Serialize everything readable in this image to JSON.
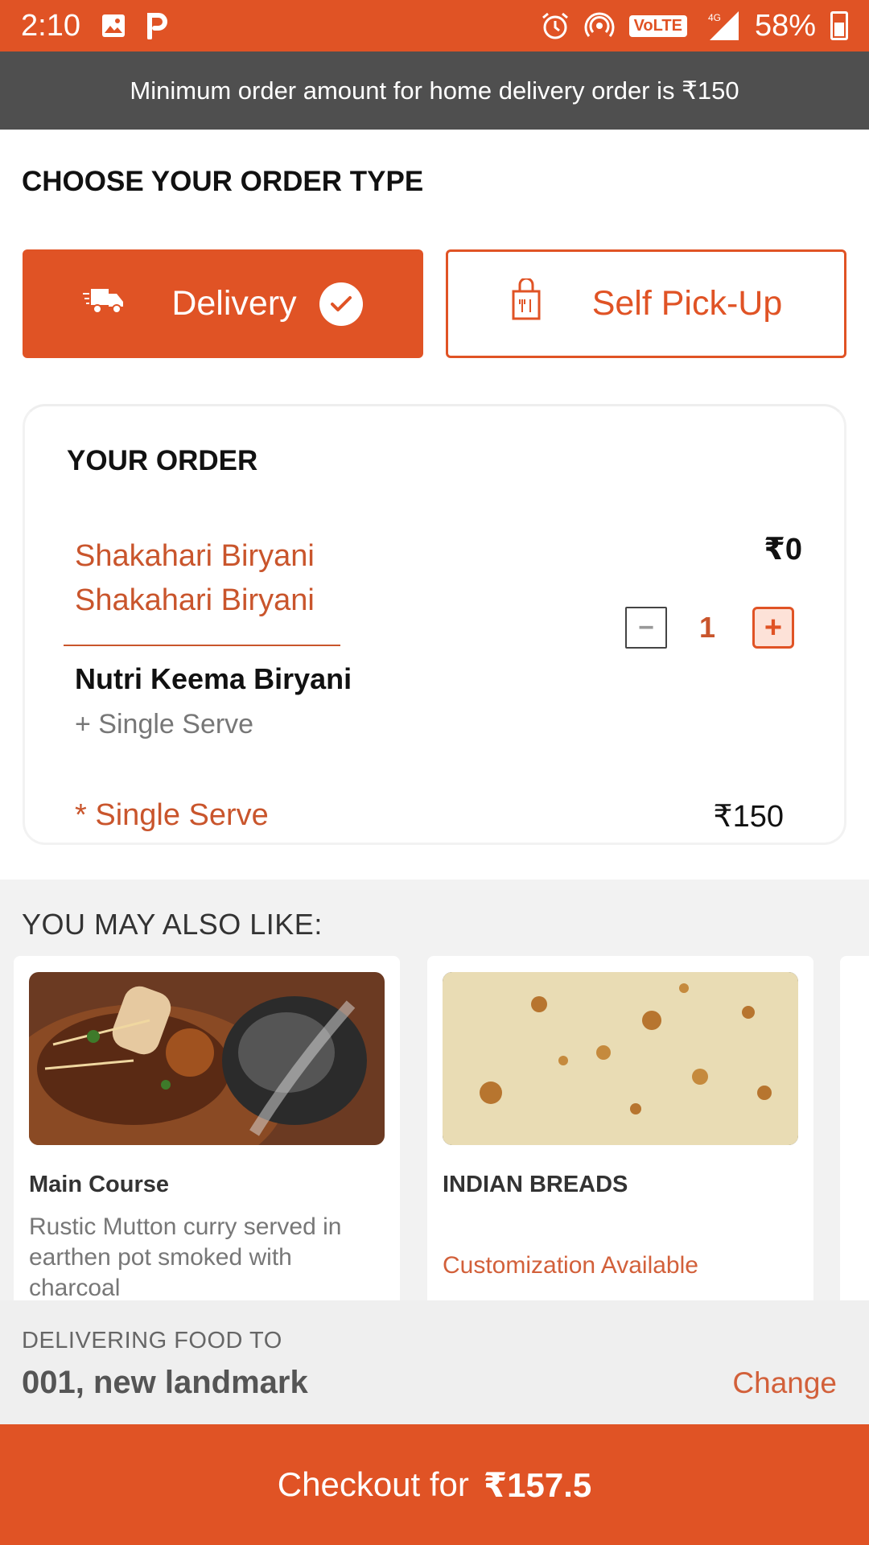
{
  "status_bar": {
    "time": "2:10",
    "network": "VoLTE",
    "network_type": "4G",
    "battery": "58%",
    "icons": [
      "image-icon",
      "parking-icon",
      "alarm-icon",
      "hotspot-icon",
      "signal-icon",
      "battery-icon"
    ]
  },
  "banner": {
    "text": "Minimum order amount for home delivery order is ₹150"
  },
  "order_type": {
    "title": "CHOOSE YOUR ORDER TYPE",
    "delivery_label": "Delivery",
    "pickup_label": "Self Pick-Up",
    "selected": "Delivery"
  },
  "order": {
    "title": "YOUR ORDER",
    "item_line1": "Shakahari Biryani",
    "item_line2": "Shakahari Biryani",
    "item_price": "₹0",
    "quantity": "1",
    "minus_label": "−",
    "plus_label": "+",
    "sub_item_name": "Nutri Keema Biryani",
    "sub_item_option": "+ Single Serve",
    "serve_label": "* Single Serve",
    "serve_price": "₹150"
  },
  "also_like": {
    "title": "YOU MAY ALSO LIKE:",
    "cards": [
      {
        "name": "Main Course",
        "description": "Rustic Mutton curry served in earthen pot smoked with charcoal",
        "image": "mutton-curry-image"
      },
      {
        "name": "INDIAN BREADS",
        "customization": "Customization Available",
        "image": "roti-image"
      }
    ]
  },
  "delivery_info": {
    "label": "DELIVERING FOOD TO",
    "address": "001, new landmark",
    "change_label": "Change"
  },
  "checkout": {
    "label": "Checkout for",
    "amount": "₹157.5"
  },
  "colors": {
    "accent": "#E05325",
    "accent_text": "#C9552C",
    "banner_bg": "#4f4f4f"
  }
}
